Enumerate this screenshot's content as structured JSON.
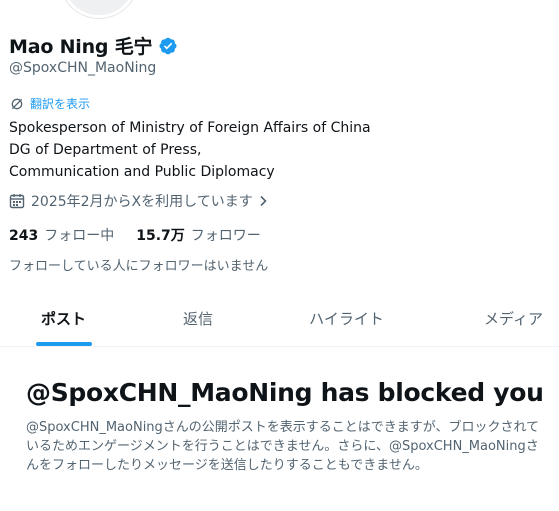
{
  "profile": {
    "display_name": "Mao Ning 毛宁",
    "handle": "@SpoxCHN_MaoNing",
    "translate_label": "翻訳を表示",
    "bio_lines": [
      "Spokesperson of Ministry of Foreign Affairs of China",
      "DG of Department of Press,",
      "Communication and Public Diplomacy"
    ],
    "joined": "2025年2月からXを利用しています",
    "following_count": "243",
    "following_label": "フォロー中",
    "followers_count": "15.7万",
    "followers_label": "フォロワー",
    "no_followers_you_know": "フォローしている人にフォロワーはいません"
  },
  "tabs": [
    {
      "label": "ポスト",
      "active": true
    },
    {
      "label": "返信",
      "active": false
    },
    {
      "label": "ハイライト",
      "active": false
    },
    {
      "label": "メディア",
      "active": false
    }
  ],
  "blocked": {
    "title": "@SpoxCHN_MaoNing has blocked you",
    "body": "@SpoxCHN_MaoNingさんの公開ポストを表示することはできますが、ブロックされているためエンゲージメントを行うことはできません。さらに、@SpoxCHN_MaoNingさんをフォローしたりメッセージを送信したりすることもできません。"
  },
  "colors": {
    "accent": "#1d9bf0",
    "text_primary": "#0f1419",
    "text_secondary": "#536471"
  },
  "icons": [
    "verified-badge-icon",
    "translate-icon",
    "calendar-icon",
    "chevron-right-icon"
  ]
}
